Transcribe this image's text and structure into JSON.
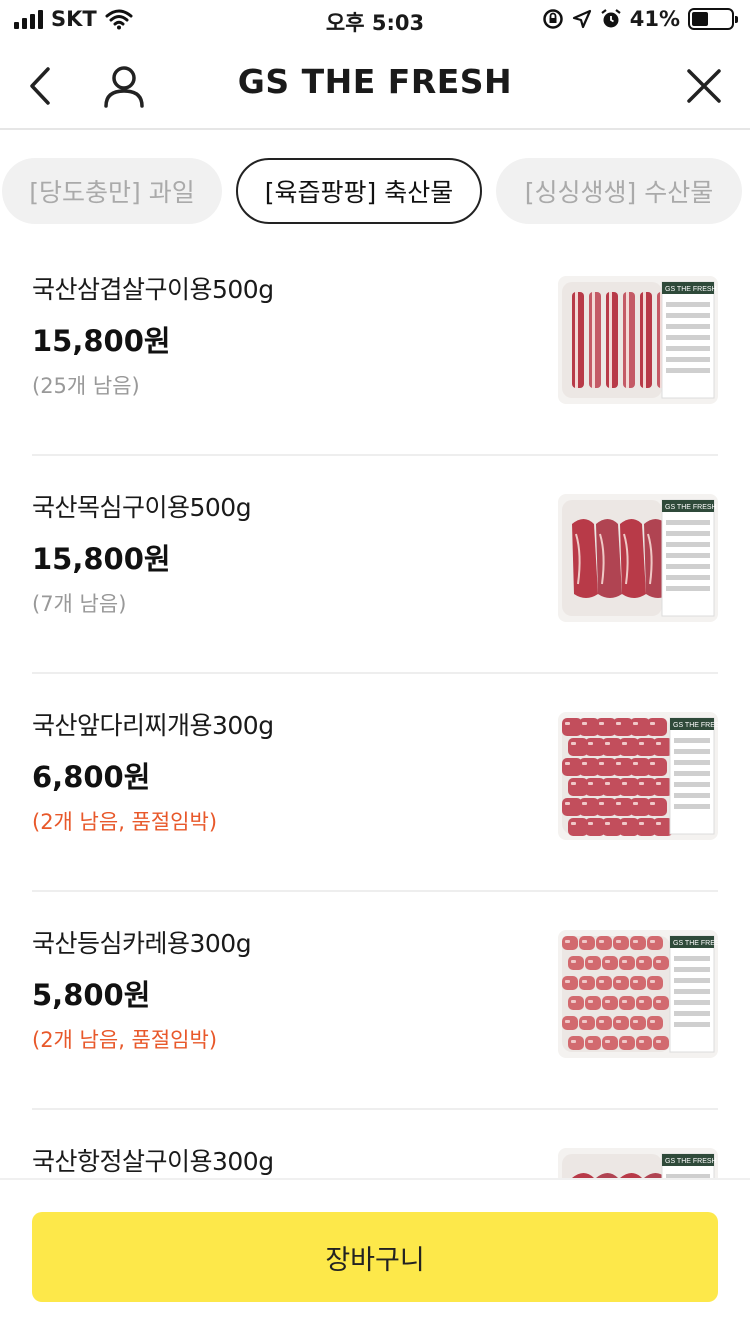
{
  "status_bar": {
    "carrier": "SKT",
    "time": "오후 5:03",
    "battery": "41%",
    "battery_level": 0.41
  },
  "header": {
    "title": "GS THE FRESH",
    "back_icon": "chevron-left-icon",
    "profile_icon": "person-icon",
    "close_icon": "close-icon"
  },
  "tabs": [
    {
      "label": "[당도충만] 과일",
      "active": false
    },
    {
      "label": "[육즙팡팡] 축산물",
      "active": true
    },
    {
      "label": "[싱싱생생] 수산물",
      "active": false
    }
  ],
  "products": [
    {
      "name": "국산삼겹살구이용500g",
      "price": "15,800원",
      "stock": "(25개 남음)",
      "low_stock": false
    },
    {
      "name": "국산목심구이용500g",
      "price": "15,800원",
      "stock": "(7개 남음)",
      "low_stock": false
    },
    {
      "name": "국산앞다리찌개용300g",
      "price": "6,800원",
      "stock": "(2개 남음, 품절임박)",
      "low_stock": true
    },
    {
      "name": "국산등심카레용300g",
      "price": "5,800원",
      "stock": "(2개 남음, 품절임박)",
      "low_stock": true
    },
    {
      "name": "국산항정살구이용300g",
      "price": "",
      "stock": "",
      "low_stock": false
    }
  ],
  "thumb_label": "GS THE FRESH",
  "cart_button": "장바구니",
  "colors": {
    "accent": "#fde84a",
    "warning": "#e8582a",
    "meat": "#b83a48",
    "label_green": "#2f4a3a"
  }
}
